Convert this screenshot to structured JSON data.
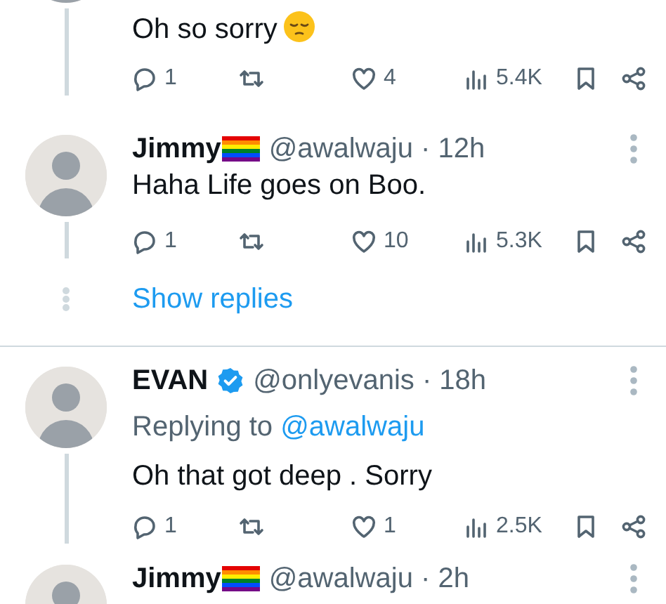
{
  "tweets": [
    {
      "kind": "continued",
      "text": "Oh so sorry",
      "trailing_emoji": true,
      "thread_line": true,
      "stats": {
        "replies": "1",
        "likes": "4",
        "views": "5.4K"
      }
    },
    {
      "kind": "full",
      "author": "Jimmy",
      "flag": true,
      "meta": "@awalwaju · 12h",
      "text": "Haha Life goes on Boo.",
      "thread_line": true,
      "stats": {
        "replies": "1",
        "likes": "10",
        "views": "5.3K"
      },
      "show_replies": "Show replies"
    },
    {
      "kind": "full",
      "author": "EVAN",
      "verified": true,
      "meta": "@onlyevanis · 18h",
      "replying_prefix": "Replying to",
      "replying_to": "@awalwaju",
      "text": "Oh that got deep . Sorry",
      "thread_line": true,
      "stats": {
        "replies": "1",
        "likes": "1",
        "views": "2.5K"
      }
    },
    {
      "kind": "full",
      "author": "Jimmy",
      "flag": true,
      "meta": "@awalwaju · 2h"
    }
  ]
}
